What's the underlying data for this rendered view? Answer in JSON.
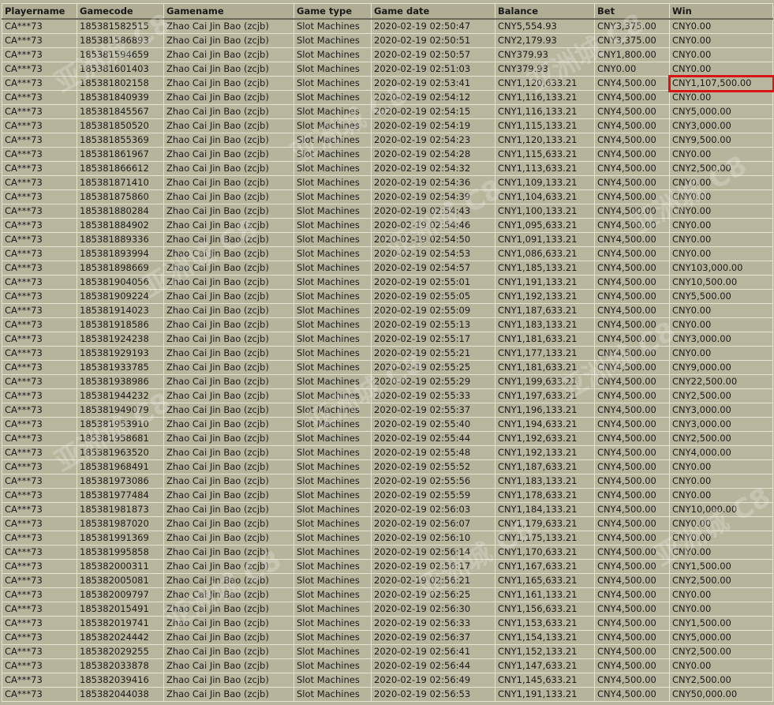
{
  "columns": [
    "Playername",
    "Gamecode",
    "Gamename",
    "Game type",
    "Game date",
    "Balance",
    "Bet",
    "Win"
  ],
  "rows": [
    [
      "CA***73",
      "185381582515",
      "Zhao Cai Jin Bao (zcjb)",
      "Slot Machines",
      "2020-02-19 02:50:47",
      "CNY5,554.93",
      "CNY3,375.00",
      "CNY0.00"
    ],
    [
      "CA***73",
      "185381586893",
      "Zhao Cai Jin Bao (zcjb)",
      "Slot Machines",
      "2020-02-19 02:50:51",
      "CNY2,179.93",
      "CNY3,375.00",
      "CNY0.00"
    ],
    [
      "CA***73",
      "185381594659",
      "Zhao Cai Jin Bao (zcjb)",
      "Slot Machines",
      "2020-02-19 02:50:57",
      "CNY379.93",
      "CNY1,800.00",
      "CNY0.00"
    ],
    [
      "CA***73",
      "185381601403",
      "Zhao Cai Jin Bao (zcjb)",
      "Slot Machines",
      "2020-02-19 02:51:03",
      "CNY379.93",
      "CNY0.00",
      "CNY0.00"
    ],
    [
      "CA***73",
      "185381802158",
      "Zhao Cai Jin Bao (zcjb)",
      "Slot Machines",
      "2020-02-19 02:53:41",
      "CNY1,120,633.21",
      "CNY4,500.00",
      "CNY1,107,500.00"
    ],
    [
      "CA***73",
      "185381840939",
      "Zhao Cai Jin Bao (zcjb)",
      "Slot Machines",
      "2020-02-19 02:54:12",
      "CNY1,116,133.21",
      "CNY4,500.00",
      "CNY0.00"
    ],
    [
      "CA***73",
      "185381845567",
      "Zhao Cai Jin Bao (zcjb)",
      "Slot Machines",
      "2020-02-19 02:54:15",
      "CNY1,116,133.21",
      "CNY4,500.00",
      "CNY5,000.00"
    ],
    [
      "CA***73",
      "185381850520",
      "Zhao Cai Jin Bao (zcjb)",
      "Slot Machines",
      "2020-02-19 02:54:19",
      "CNY1,115,133.21",
      "CNY4,500.00",
      "CNY3,000.00"
    ],
    [
      "CA***73",
      "185381855369",
      "Zhao Cai Jin Bao (zcjb)",
      "Slot Machines",
      "2020-02-19 02:54:23",
      "CNY1,120,133.21",
      "CNY4,500.00",
      "CNY9,500.00"
    ],
    [
      "CA***73",
      "185381861967",
      "Zhao Cai Jin Bao (zcjb)",
      "Slot Machines",
      "2020-02-19 02:54:28",
      "CNY1,115,633.21",
      "CNY4,500.00",
      "CNY0.00"
    ],
    [
      "CA***73",
      "185381866612",
      "Zhao Cai Jin Bao (zcjb)",
      "Slot Machines",
      "2020-02-19 02:54:32",
      "CNY1,113,633.21",
      "CNY4,500.00",
      "CNY2,500.00"
    ],
    [
      "CA***73",
      "185381871410",
      "Zhao Cai Jin Bao (zcjb)",
      "Slot Machines",
      "2020-02-19 02:54:36",
      "CNY1,109,133.21",
      "CNY4,500.00",
      "CNY0.00"
    ],
    [
      "CA***73",
      "185381875860",
      "Zhao Cai Jin Bao (zcjb)",
      "Slot Machines",
      "2020-02-19 02:54:39",
      "CNY1,104,633.21",
      "CNY4,500.00",
      "CNY0.00"
    ],
    [
      "CA***73",
      "185381880284",
      "Zhao Cai Jin Bao (zcjb)",
      "Slot Machines",
      "2020-02-19 02:54:43",
      "CNY1,100,133.21",
      "CNY4,500.00",
      "CNY0.00"
    ],
    [
      "CA***73",
      "185381884902",
      "Zhao Cai Jin Bao (zcjb)",
      "Slot Machines",
      "2020-02-19 02:54:46",
      "CNY1,095,633.21",
      "CNY4,500.00",
      "CNY0.00"
    ],
    [
      "CA***73",
      "185381889336",
      "Zhao Cai Jin Bao (zcjb)",
      "Slot Machines",
      "2020-02-19 02:54:50",
      "CNY1,091,133.21",
      "CNY4,500.00",
      "CNY0.00"
    ],
    [
      "CA***73",
      "185381893994",
      "Zhao Cai Jin Bao (zcjb)",
      "Slot Machines",
      "2020-02-19 02:54:53",
      "CNY1,086,633.21",
      "CNY4,500.00",
      "CNY0.00"
    ],
    [
      "CA***73",
      "185381898669",
      "Zhao Cai Jin Bao (zcjb)",
      "Slot Machines",
      "2020-02-19 02:54:57",
      "CNY1,185,133.21",
      "CNY4,500.00",
      "CNY103,000.00"
    ],
    [
      "CA***73",
      "185381904056",
      "Zhao Cai Jin Bao (zcjb)",
      "Slot Machines",
      "2020-02-19 02:55:01",
      "CNY1,191,133.21",
      "CNY4,500.00",
      "CNY10,500.00"
    ],
    [
      "CA***73",
      "185381909224",
      "Zhao Cai Jin Bao (zcjb)",
      "Slot Machines",
      "2020-02-19 02:55:05",
      "CNY1,192,133.21",
      "CNY4,500.00",
      "CNY5,500.00"
    ],
    [
      "CA***73",
      "185381914023",
      "Zhao Cai Jin Bao (zcjb)",
      "Slot Machines",
      "2020-02-19 02:55:09",
      "CNY1,187,633.21",
      "CNY4,500.00",
      "CNY0.00"
    ],
    [
      "CA***73",
      "185381918586",
      "Zhao Cai Jin Bao (zcjb)",
      "Slot Machines",
      "2020-02-19 02:55:13",
      "CNY1,183,133.21",
      "CNY4,500.00",
      "CNY0.00"
    ],
    [
      "CA***73",
      "185381924238",
      "Zhao Cai Jin Bao (zcjb)",
      "Slot Machines",
      "2020-02-19 02:55:17",
      "CNY1,181,633.21",
      "CNY4,500.00",
      "CNY3,000.00"
    ],
    [
      "CA***73",
      "185381929193",
      "Zhao Cai Jin Bao (zcjb)",
      "Slot Machines",
      "2020-02-19 02:55:21",
      "CNY1,177,133.21",
      "CNY4,500.00",
      "CNY0.00"
    ],
    [
      "CA***73",
      "185381933785",
      "Zhao Cai Jin Bao (zcjb)",
      "Slot Machines",
      "2020-02-19 02:55:25",
      "CNY1,181,633.21",
      "CNY4,500.00",
      "CNY9,000.00"
    ],
    [
      "CA***73",
      "185381938986",
      "Zhao Cai Jin Bao (zcjb)",
      "Slot Machines",
      "2020-02-19 02:55:29",
      "CNY1,199,633.21",
      "CNY4,500.00",
      "CNY22,500.00"
    ],
    [
      "CA***73",
      "185381944232",
      "Zhao Cai Jin Bao (zcjb)",
      "Slot Machines",
      "2020-02-19 02:55:33",
      "CNY1,197,633.21",
      "CNY4,500.00",
      "CNY2,500.00"
    ],
    [
      "CA***73",
      "185381949079",
      "Zhao Cai Jin Bao (zcjb)",
      "Slot Machines",
      "2020-02-19 02:55:37",
      "CNY1,196,133.21",
      "CNY4,500.00",
      "CNY3,000.00"
    ],
    [
      "CA***73",
      "185381953910",
      "Zhao Cai Jin Bao (zcjb)",
      "Slot Machines",
      "2020-02-19 02:55:40",
      "CNY1,194,633.21",
      "CNY4,500.00",
      "CNY3,000.00"
    ],
    [
      "CA***73",
      "185381958681",
      "Zhao Cai Jin Bao (zcjb)",
      "Slot Machines",
      "2020-02-19 02:55:44",
      "CNY1,192,633.21",
      "CNY4,500.00",
      "CNY2,500.00"
    ],
    [
      "CA***73",
      "185381963520",
      "Zhao Cai Jin Bao (zcjb)",
      "Slot Machines",
      "2020-02-19 02:55:48",
      "CNY1,192,133.21",
      "CNY4,500.00",
      "CNY4,000.00"
    ],
    [
      "CA***73",
      "185381968491",
      "Zhao Cai Jin Bao (zcjb)",
      "Slot Machines",
      "2020-02-19 02:55:52",
      "CNY1,187,633.21",
      "CNY4,500.00",
      "CNY0.00"
    ],
    [
      "CA***73",
      "185381973086",
      "Zhao Cai Jin Bao (zcjb)",
      "Slot Machines",
      "2020-02-19 02:55:56",
      "CNY1,183,133.21",
      "CNY4,500.00",
      "CNY0.00"
    ],
    [
      "CA***73",
      "185381977484",
      "Zhao Cai Jin Bao (zcjb)",
      "Slot Machines",
      "2020-02-19 02:55:59",
      "CNY1,178,633.21",
      "CNY4,500.00",
      "CNY0.00"
    ],
    [
      "CA***73",
      "185381981873",
      "Zhao Cai Jin Bao (zcjb)",
      "Slot Machines",
      "2020-02-19 02:56:03",
      "CNY1,184,133.21",
      "CNY4,500.00",
      "CNY10,000.00"
    ],
    [
      "CA***73",
      "185381987020",
      "Zhao Cai Jin Bao (zcjb)",
      "Slot Machines",
      "2020-02-19 02:56:07",
      "CNY1,179,633.21",
      "CNY4,500.00",
      "CNY0.00"
    ],
    [
      "CA***73",
      "185381991369",
      "Zhao Cai Jin Bao (zcjb)",
      "Slot Machines",
      "2020-02-19 02:56:10",
      "CNY1,175,133.21",
      "CNY4,500.00",
      "CNY0.00"
    ],
    [
      "CA***73",
      "185381995858",
      "Zhao Cai Jin Bao (zcjb)",
      "Slot Machines",
      "2020-02-19 02:56:14",
      "CNY1,170,633.21",
      "CNY4,500.00",
      "CNY0.00"
    ],
    [
      "CA***73",
      "185382000311",
      "Zhao Cai Jin Bao (zcjb)",
      "Slot Machines",
      "2020-02-19 02:56:17",
      "CNY1,167,633.21",
      "CNY4,500.00",
      "CNY1,500.00"
    ],
    [
      "CA***73",
      "185382005081",
      "Zhao Cai Jin Bao (zcjb)",
      "Slot Machines",
      "2020-02-19 02:56:21",
      "CNY1,165,633.21",
      "CNY4,500.00",
      "CNY2,500.00"
    ],
    [
      "CA***73",
      "185382009797",
      "Zhao Cai Jin Bao (zcjb)",
      "Slot Machines",
      "2020-02-19 02:56:25",
      "CNY1,161,133.21",
      "CNY4,500.00",
      "CNY0.00"
    ],
    [
      "CA***73",
      "185382015491",
      "Zhao Cai Jin Bao (zcjb)",
      "Slot Machines",
      "2020-02-19 02:56:30",
      "CNY1,156,633.21",
      "CNY4,500.00",
      "CNY0.00"
    ],
    [
      "CA***73",
      "185382019741",
      "Zhao Cai Jin Bao (zcjb)",
      "Slot Machines",
      "2020-02-19 02:56:33",
      "CNY1,153,633.21",
      "CNY4,500.00",
      "CNY1,500.00"
    ],
    [
      "CA***73",
      "185382024442",
      "Zhao Cai Jin Bao (zcjb)",
      "Slot Machines",
      "2020-02-19 02:56:37",
      "CNY1,154,133.21",
      "CNY4,500.00",
      "CNY5,000.00"
    ],
    [
      "CA***73",
      "185382029255",
      "Zhao Cai Jin Bao (zcjb)",
      "Slot Machines",
      "2020-02-19 02:56:41",
      "CNY1,152,133.21",
      "CNY4,500.00",
      "CNY2,500.00"
    ],
    [
      "CA***73",
      "185382033878",
      "Zhao Cai Jin Bao (zcjb)",
      "Slot Machines",
      "2020-02-19 02:56:44",
      "CNY1,147,633.21",
      "CNY4,500.00",
      "CNY0.00"
    ],
    [
      "CA***73",
      "185382039416",
      "Zhao Cai Jin Bao (zcjb)",
      "Slot Machines",
      "2020-02-19 02:56:49",
      "CNY1,145,633.21",
      "CNY4,500.00",
      "CNY2,500.00"
    ],
    [
      "CA***73",
      "185382044038",
      "Zhao Cai Jin Bao (zcjb)",
      "Slot Machines",
      "2020-02-19 02:56:53",
      "CNY1,191,133.21",
      "CNY4,500.00",
      "CNY50,000.00"
    ]
  ],
  "highlight": {
    "row": 4,
    "column": 7,
    "color": "#d81414"
  },
  "watermark": {
    "text": "亚洲城 C8"
  }
}
